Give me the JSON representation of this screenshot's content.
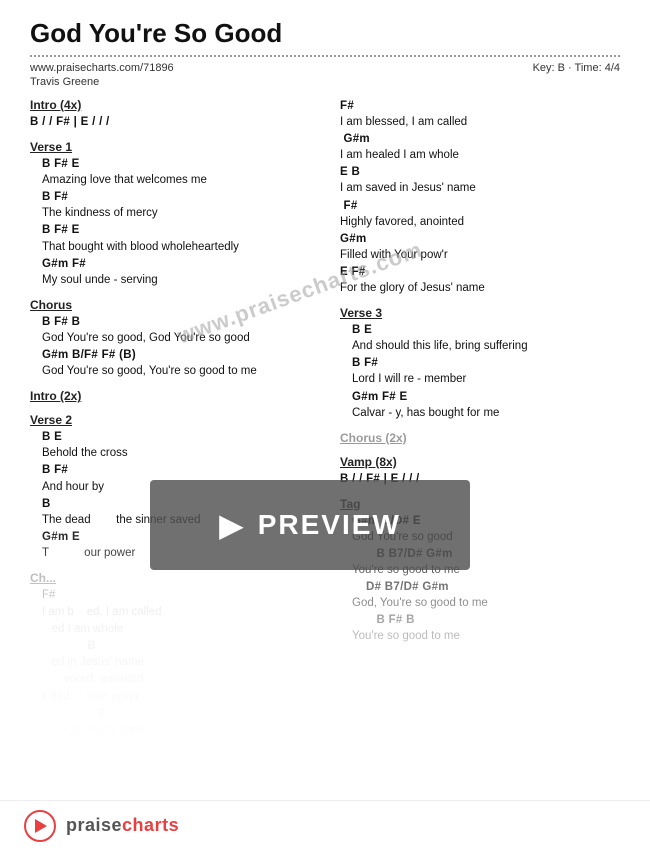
{
  "title": "God You're So Good",
  "url": "www.praisecharts.com/71896",
  "author": "Travis Greene",
  "key": "Key: B",
  "time": "Time: 4/4",
  "sections": {
    "intro": {
      "label": "Intro (4x)",
      "chords": "B  /  /  F#  |  E  /  /  /"
    },
    "verse1": {
      "label": "Verse 1",
      "lines": [
        {
          "chord": "B          F#    E",
          "lyric": "Amazing love  that welcomes me"
        },
        {
          "chord": "B                F#",
          "lyric": "The kindness of mercy"
        },
        {
          "chord": "B               F#     E",
          "lyric": "That bought with  blood  wholeheartedly"
        },
        {
          "chord": "G#m            F#",
          "lyric": "My soul unde - serving"
        }
      ]
    },
    "chorus": {
      "label": "Chorus",
      "lines": [
        {
          "chord": "B          F#               B",
          "lyric": "God You're so good, God You're so good"
        },
        {
          "chord": "G#m               B/F#  F#  (B)",
          "lyric": "God You're so good, You're so good  to  me"
        }
      ]
    },
    "intro2": {
      "label": "Intro (2x)"
    },
    "verse2": {
      "label": "Verse 2",
      "lines": [
        {
          "chord": "B                    E",
          "lyric": "Behold the cross"
        },
        {
          "chord": "B                 F#",
          "lyric": "And hour by"
        },
        {
          "chord": "B",
          "lyric": "The dead        the sinner saved"
        },
        {
          "chord": "G#m             E",
          "lyric": "T          our power"
        }
      ]
    },
    "chorus2_ref": {
      "label": "Ch...",
      "faded": true
    }
  },
  "right_col": {
    "chorus_cont": [
      {
        "chord": "F#",
        "lyric": "I am blessed, I am called"
      },
      {
        "chord": "G#m",
        "lyric": "I am healed I am whole"
      },
      {
        "chord": "E              B",
        "lyric": "I am saved in Jesus' name"
      },
      {
        "chord": "F#",
        "lyric": "Highly favored, anointed"
      },
      {
        "chord": "G#m",
        "lyric": "Filled with Your pow'r"
      },
      {
        "chord": "E              F#",
        "lyric": "For the glory of Jesus' name"
      }
    ],
    "verse3": {
      "label": "Verse 3",
      "lines": [
        {
          "chord": "B                    E",
          "lyric": "And should this life,   bring suffering"
        },
        {
          "chord": "B               F#",
          "lyric": "Lord I will re - member"
        },
        {
          "chord": "G#m            F#  E",
          "lyric": "Calvar - y,   has bought for me"
        }
      ]
    },
    "chorus_2x": {
      "label": "Chorus (2x)",
      "faded": true
    },
    "vamp": {
      "label": "Vamp (8x)",
      "chords": "B  /  /  F#  |  E  /  /  /"
    },
    "tag": {
      "label": "Tag",
      "lines": [
        {
          "chord": "G#m    B/D#  E",
          "lyric": "God You're  so  good"
        },
        {
          "chord": "       B   B7/D#  G#m",
          "lyric": "You're so good  to   me"
        },
        {
          "chord": "   D#    B7/D#  G#m",
          "lyric": "God, You're so good  to   me"
        },
        {
          "chord": "       B    F#  B",
          "lyric": "You're so good  to  me"
        }
      ]
    }
  },
  "footer": {
    "brand": "praisecharts"
  },
  "watermark": "www.praisecharts.com",
  "preview_label": "PREVIEW"
}
